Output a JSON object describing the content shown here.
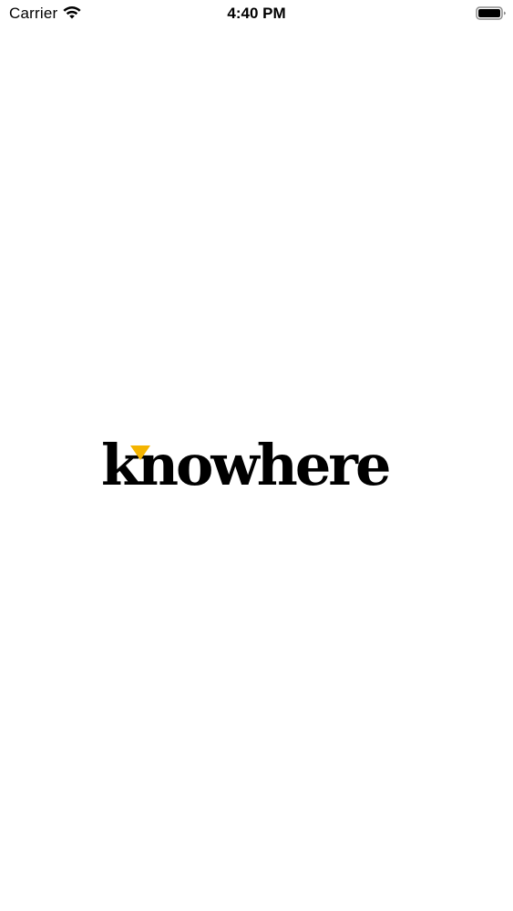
{
  "status_bar": {
    "carrier": "Carrier",
    "time": "4:40 PM",
    "wifi_icon": "wifi-icon",
    "battery_icon": "battery-icon"
  },
  "splash": {
    "logo_text": "knowhere",
    "accent_icon": "triangle-down-icon",
    "colors": {
      "text": "#0b0b0b",
      "accent": "#f4b400",
      "background": "#ffffff"
    }
  }
}
